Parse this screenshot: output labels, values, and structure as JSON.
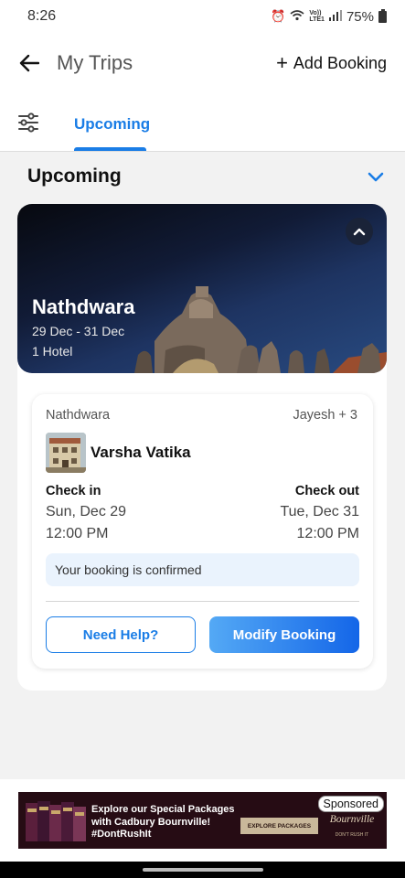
{
  "status_bar": {
    "time": "8:26",
    "network": "Vo))\nLTE1",
    "battery": "75%"
  },
  "header": {
    "title": "My Trips",
    "add_booking": "Add Booking"
  },
  "tabs": {
    "active": "Upcoming"
  },
  "section": {
    "title": "Upcoming"
  },
  "trip": {
    "city": "Nathdwara",
    "dates": "29 Dec - 31 Dec",
    "count": "1 Hotel",
    "booking": {
      "city": "Nathdwara",
      "guests": "Jayesh + 3",
      "hotel_name": "Varsha Vatika",
      "check_in_label": "Check in",
      "check_in_date": "Sun, Dec 29",
      "check_in_time": "12:00 PM",
      "check_out_label": "Check out",
      "check_out_date": "Tue, Dec 31",
      "check_out_time": "12:00 PM",
      "status": "Your booking is confirmed",
      "help_button": "Need Help?",
      "modify_button": "Modify Booking"
    }
  },
  "ad": {
    "line1": "Explore our Special Packages",
    "line2": "with Cadbury Bournville!",
    "line3": "#DontRushIt",
    "cta": "EXPLORE PACKAGES",
    "brand": "Bournville",
    "tagline": "DON'T RUSH IT",
    "sponsored": "Sponsored"
  },
  "colors": {
    "accent": "#1a7de6",
    "status_box": "#eaf3fd",
    "page_bg": "#f2f2f2"
  }
}
